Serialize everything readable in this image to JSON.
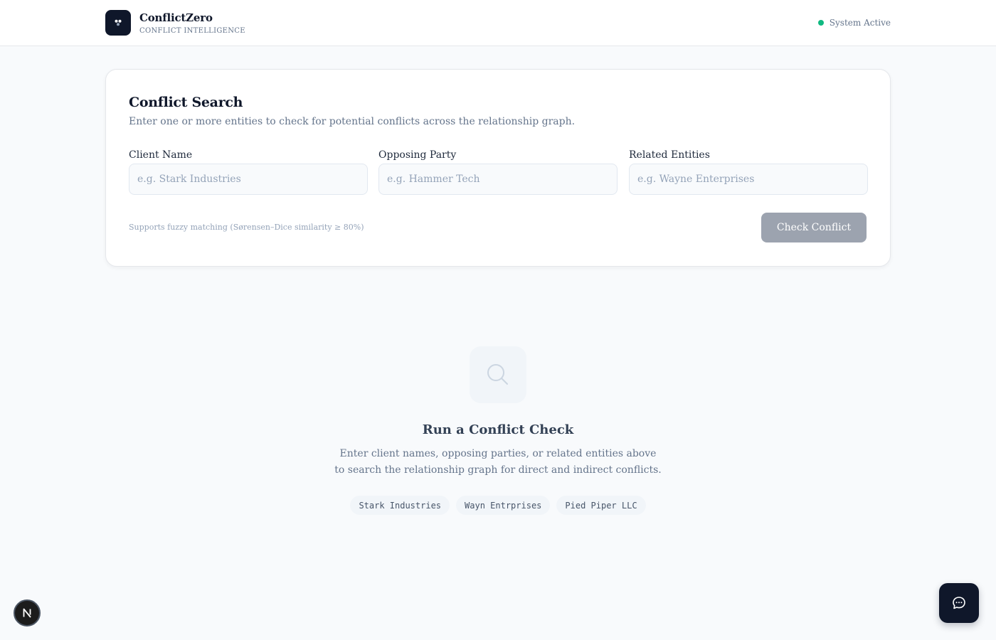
{
  "header": {
    "logo_icon": "graph-nodes-icon",
    "app_name": "ConflictZero",
    "app_subtitle": "CONFLICT INTELLIGENCE",
    "status_text": "System Active",
    "status_color": "#10b981"
  },
  "search_card": {
    "title": "Conflict Search",
    "description": "Enter one or more entities to check for potential conflicts across the relationship graph.",
    "fields": [
      {
        "label": "Client Name",
        "placeholder": "e.g. Stark Industries",
        "value": ""
      },
      {
        "label": "Opposing Party",
        "placeholder": "e.g. Hammer Tech",
        "value": ""
      },
      {
        "label": "Related Entities",
        "placeholder": "e.g. Wayne Enterprises",
        "value": ""
      }
    ],
    "hint": "Supports fuzzy matching (Sørensen–Dice similarity ≥ 80%)",
    "submit_label": "Check Conflict",
    "submit_disabled": true
  },
  "empty_state": {
    "icon": "search-icon",
    "title": "Run a Conflict Check",
    "description": "Enter client names, opposing parties, or related entities above to search the relationship graph for direct and indirect conflicts.",
    "examples": [
      "Stark Industries",
      "Wayn Entrprises",
      "Pied Piper LLC"
    ]
  },
  "floating": {
    "dev_badge_icon": "nextjs-logo-icon",
    "dev_badge_letter": "N",
    "chat_icon": "chat-bubble-icon"
  },
  "colors": {
    "brand_dark": "#0f172a",
    "button_disabled": "#9ca3af",
    "page_bg": "#f8fafc"
  }
}
